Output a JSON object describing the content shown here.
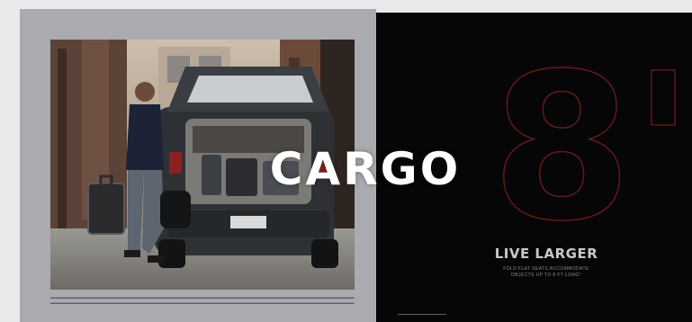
{
  "overlay": {
    "title": "CARGO"
  },
  "right_page": {
    "big_number": "8'",
    "headline": "LIVE LARGER",
    "tagline_line1": "FOLD FLAT SEATS ACCOMMODATE",
    "tagline_line2": "OBJECTS UP TO 8 FT LONG*"
  },
  "colors": {
    "left_page_bg": "#a9abb0",
    "right_page_bg": "#060606",
    "outline_red": "#6a1a1a",
    "title_white": "#ffffff"
  }
}
